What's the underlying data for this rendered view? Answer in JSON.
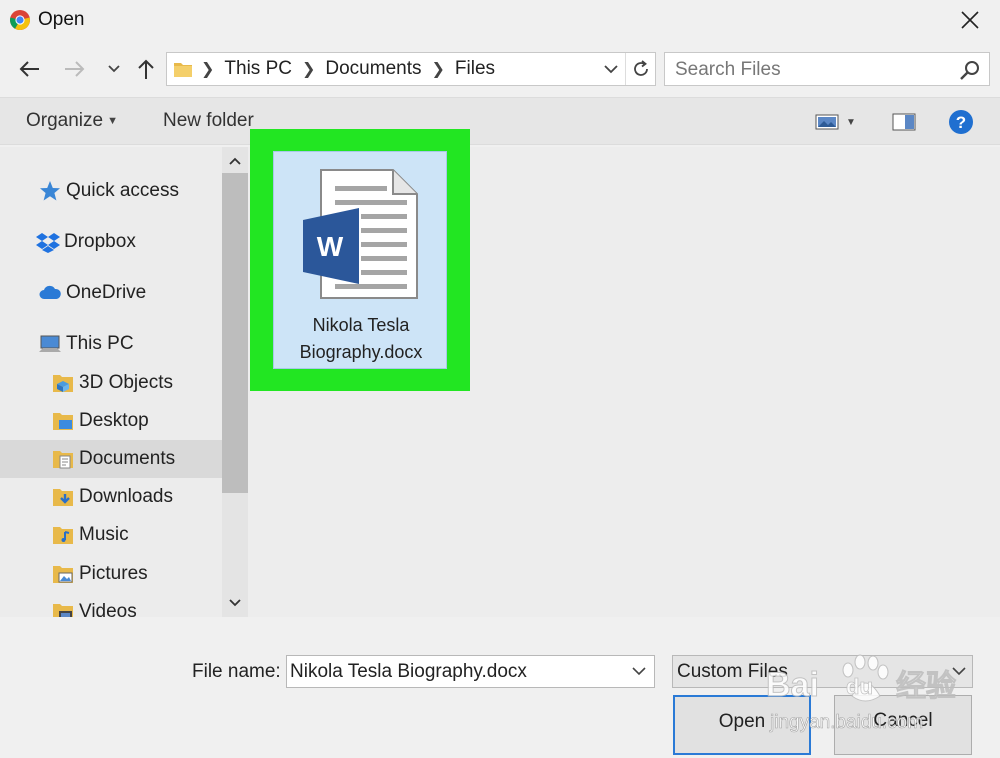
{
  "window": {
    "title": "Open"
  },
  "address": {
    "crumbs": [
      "This PC",
      "Documents",
      "Files"
    ]
  },
  "search": {
    "placeholder": "Search Files"
  },
  "toolbar": {
    "organize": "Organize",
    "new_folder": "New folder"
  },
  "sidebar": {
    "items": [
      {
        "label": "Quick access",
        "icon": "star-icon"
      },
      {
        "label": "Dropbox",
        "icon": "dropbox-icon"
      },
      {
        "label": "OneDrive",
        "icon": "cloud-icon"
      },
      {
        "label": "This PC",
        "icon": "computer-icon"
      },
      {
        "label": "3D Objects",
        "icon": "folder-3d-icon"
      },
      {
        "label": "Desktop",
        "icon": "folder-desktop-icon"
      },
      {
        "label": "Documents",
        "icon": "folder-documents-icon",
        "selected": true
      },
      {
        "label": "Downloads",
        "icon": "folder-downloads-icon"
      },
      {
        "label": "Music",
        "icon": "folder-music-icon"
      },
      {
        "label": "Pictures",
        "icon": "folder-pictures-icon"
      },
      {
        "label": "Videos",
        "icon": "folder-videos-icon"
      }
    ]
  },
  "files": [
    {
      "name_line1": "Nikola Tesla",
      "name_line2": "Biography.docx",
      "icon": "word-document-icon"
    }
  ],
  "bottom": {
    "file_name_label": "File name:",
    "file_name_value": "Nikola Tesla Biography.docx",
    "file_type": "Custom Files",
    "open_label": "Open",
    "cancel_label": "Cancel"
  },
  "watermark": {
    "brand": "Bai",
    "brand2": "du",
    "suffix": "经验",
    "url": "jingyan.baidu.com"
  },
  "colors": {
    "highlight": "#22e622",
    "accent": "#2a7ad6",
    "word_blue": "#2b579a",
    "help_blue": "#1f6fd0"
  }
}
